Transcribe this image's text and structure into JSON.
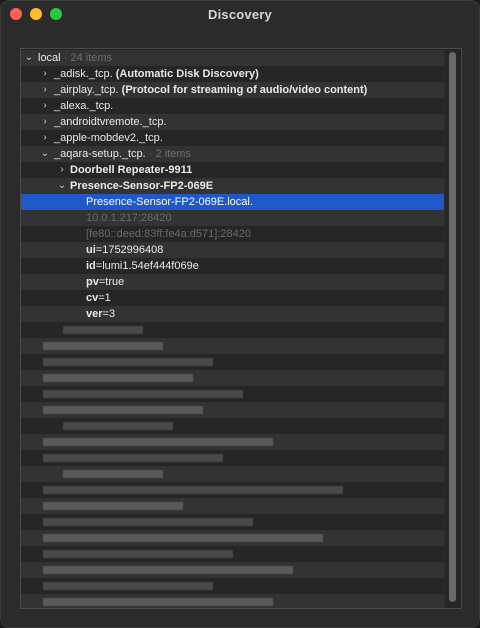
{
  "window": {
    "title": "Discovery"
  },
  "tree": {
    "root": {
      "label": "local",
      "count": "24 items"
    },
    "services": [
      {
        "name": "_adisk._tcp.",
        "desc": "(Automatic Disk Discovery)"
      },
      {
        "name": "_airplay._tcp.",
        "desc": "(Protocol for streaming of audio/video content)"
      },
      {
        "name": "_alexa._tcp.",
        "desc": ""
      },
      {
        "name": "_androidtvremote._tcp.",
        "desc": ""
      },
      {
        "name": "_apple-mobdev2._tcp.",
        "desc": ""
      }
    ],
    "expanded_service": {
      "name": "_aqara-setup._tcp.",
      "count": "2 items",
      "devices": [
        {
          "name": "Doorbell Repeater-9911"
        },
        {
          "name": "Presence-Sensor-FP2-069E",
          "hostname": "Presence-Sensor-FP2-069E.local.",
          "ipv4": "10.0.1.217:28420",
          "ipv6": "[fe80::deed:83ff:fe4a:d571]:28420",
          "txt": [
            {
              "key": "ui",
              "value": "=1752996408"
            },
            {
              "key": "id",
              "value": "=lumi1.54ef444f069e"
            },
            {
              "key": "pv",
              "value": "=true"
            },
            {
              "key": "cv",
              "value": "=1"
            },
            {
              "key": "ver",
              "value": "=3"
            }
          ]
        }
      ]
    }
  },
  "colors": {
    "selection": "#1e58c9",
    "row_alt": "#333333",
    "row_base": "#262626"
  },
  "icons": [
    "chevron-right-icon",
    "chevron-down-icon"
  ]
}
